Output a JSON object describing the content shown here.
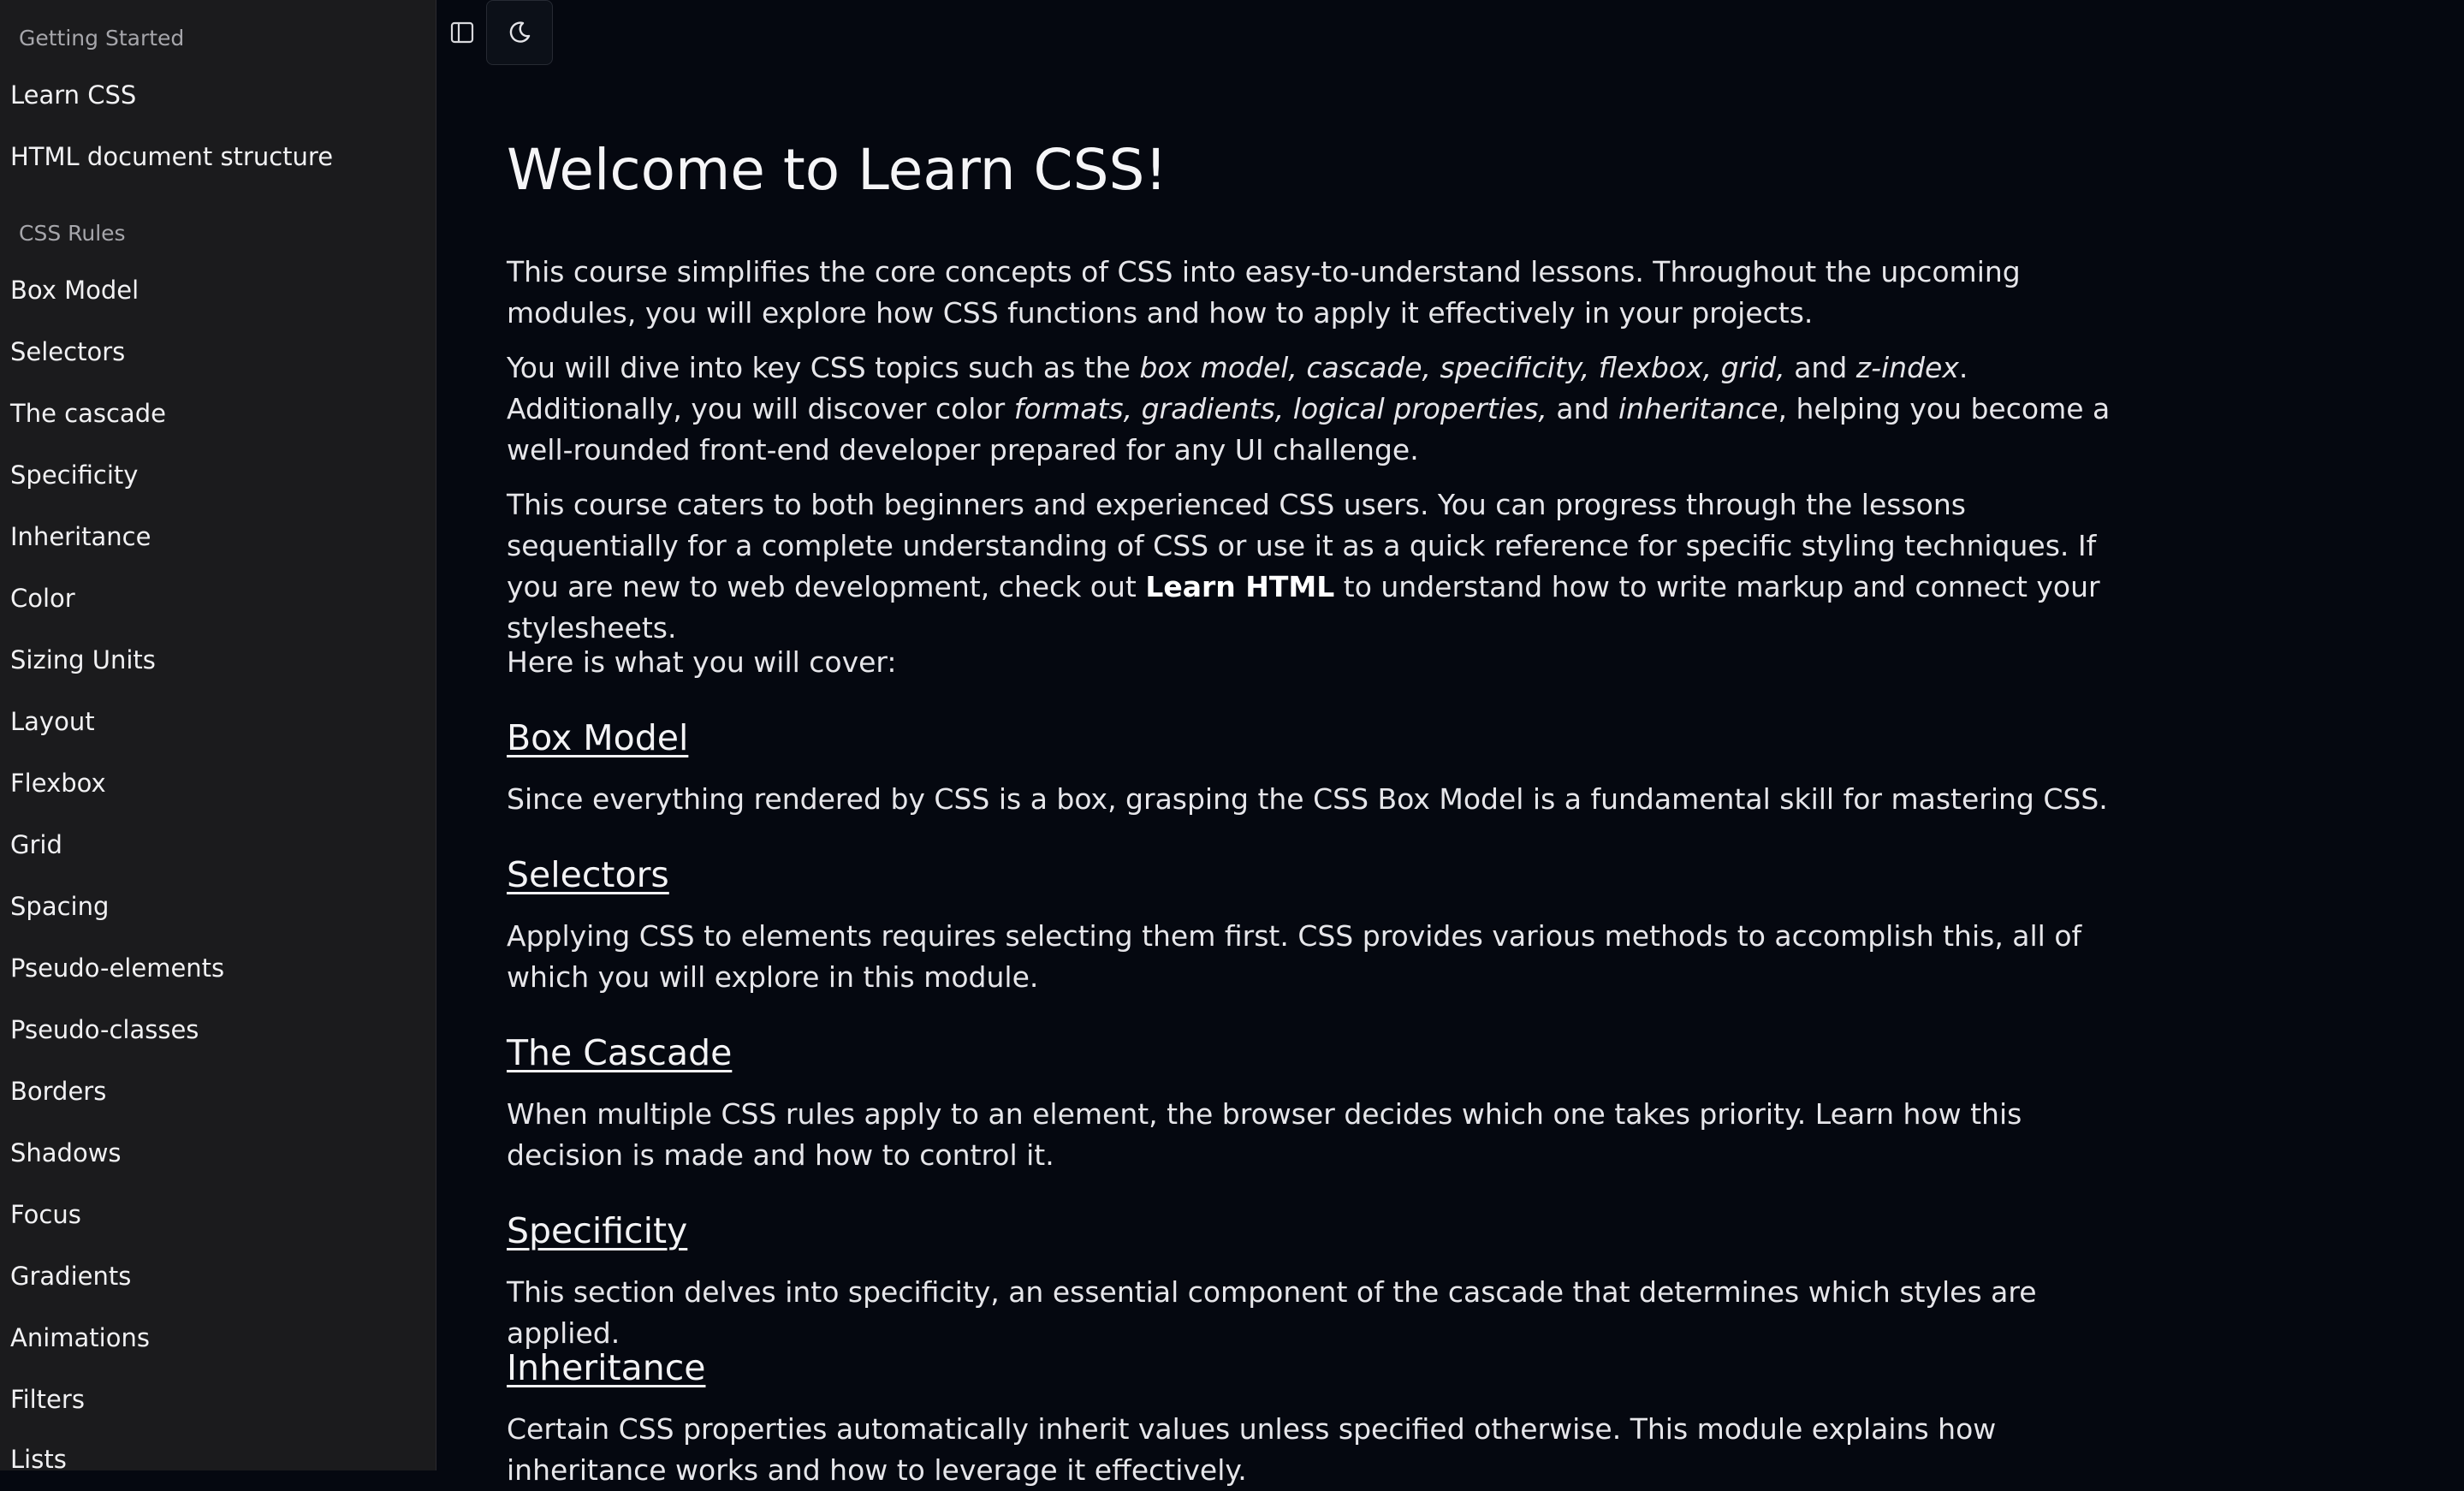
{
  "sidebar": {
    "groups": [
      {
        "title": "Getting Started",
        "items": [
          "Learn CSS",
          "HTML document structure"
        ]
      },
      {
        "title": "CSS Rules",
        "items": [
          "Box Model",
          "Selectors",
          "The cascade",
          "Specificity",
          "Inheritance",
          "Color",
          "Sizing Units",
          "Layout",
          "Flexbox",
          "Grid",
          "Spacing",
          "Pseudo-elements",
          "Pseudo-classes",
          "Borders",
          "Shadows",
          "Focus",
          "Gradients",
          "Animations",
          "Filters",
          "Lists"
        ]
      }
    ]
  },
  "toolbar": {
    "sidebar_toggle_icon": "sidebar-panel-icon",
    "theme_toggle_icon": "moon-icon"
  },
  "main": {
    "title": "Welcome to Learn CSS!",
    "intro": {
      "p1": "This course simplifies the core concepts of CSS into easy-to-understand lessons. Throughout the upcoming modules, you will explore how CSS functions and how to apply it effectively in your projects.",
      "p2": {
        "t1": "You will dive into key CSS topics such as the ",
        "e1": "box model, cascade, specificity, flexbox, grid,",
        "t2": " and ",
        "e2": "z-index",
        "t3": ". Additionally, you will discover color ",
        "e3": "formats, gradients, logical properties,",
        "t4": " and ",
        "e4": "inheritance",
        "t5": ", helping you become a well-rounded front-end developer prepared for any UI challenge."
      },
      "p3": {
        "t1": "This course caters to both beginners and experienced CSS users. You can progress through the lessons sequentially for a complete understanding of CSS or use it as a quick reference for specific styling techniques. If you are new to web development, check out ",
        "link": "Learn HTML",
        "t2": " to understand how to write markup and connect your stylesheets."
      },
      "cover": "Here is what you will cover:"
    },
    "sections": [
      {
        "heading": "Box Model",
        "text": "Since everything rendered by CSS is a box, grasping the CSS Box Model is a fundamental skill for mastering CSS."
      },
      {
        "heading": "Selectors",
        "text": "Applying CSS to elements requires selecting them first. CSS provides various methods to accomplish this, all of which you will explore in this module."
      },
      {
        "heading": "The Cascade",
        "text": "When multiple CSS rules apply to an element, the browser decides which one takes priority. Learn how this decision is made and how to control it."
      },
      {
        "heading": "Specificity",
        "text": "This section delves into specificity, an essential component of the cascade that determines which styles are applied."
      },
      {
        "heading": "Inheritance",
        "text": "Certain CSS properties automatically inherit values unless specified otherwise. This module explains how inheritance works and how to leverage it effectively."
      }
    ]
  },
  "colors": {
    "sidebar_bg": "#1b1b1d",
    "main_bg": "#050810",
    "text": "#e6e6ea"
  }
}
